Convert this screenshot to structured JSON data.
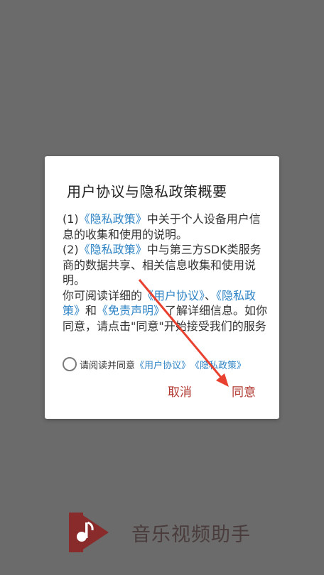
{
  "dialog": {
    "title": "用户协议与隐私政策概要",
    "p1_prefix": "(1)",
    "p1_link": "《隐私政策》",
    "p1_text": "中关于个人设备用户信息的收集和使用的说明。",
    "p2_prefix": "(2)",
    "p2_link": "《隐私政策》",
    "p2_text": "中与第三方SDK类服务商的数据共享、相关信息收集和使用说明。",
    "p3_text1": "你可阅读详细的",
    "p3_link1": "《用户协议》",
    "p3_sep": "、",
    "p3_link2": "《隐私政策》",
    "p3_and": "和",
    "p3_link3": "《免责声明》",
    "p3_text2": "了解详细信息。如你同意，请点击\"同意\"开始接受我们的服务",
    "agree_text": "请阅读并同意",
    "agree_link1": "《用户协议》",
    "agree_link2": "《隐私政策》",
    "cancel_label": "取消",
    "ok_label": "同意"
  },
  "app": {
    "name": "音乐视频助手",
    "logo_icon": "play-note-logo-icon"
  },
  "colors": {
    "link": "#2f84c5",
    "button": "#b23a33",
    "annotation_arrow": "#e8412f",
    "brand": "#8a2b2b"
  }
}
